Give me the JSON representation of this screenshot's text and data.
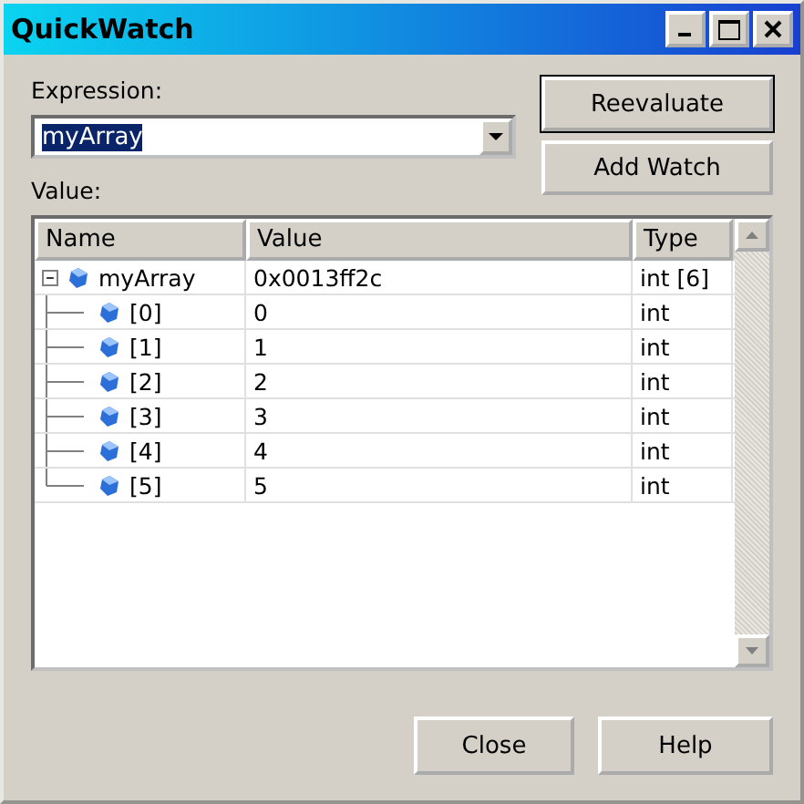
{
  "window": {
    "title": "QuickWatch"
  },
  "expression": {
    "label": "Expression:",
    "value": "myArray"
  },
  "buttons": [
    "Reevaluate",
    "Add Watch"
  ],
  "value_label": "Value:",
  "table": {
    "columns": [
      "Name",
      "Value",
      "Type"
    ],
    "rows": [
      {
        "name": "myArray",
        "value": "0x0013ff2c",
        "type": "int [6]",
        "expanded": true,
        "children": [
          {
            "name": "[0]",
            "value": "0",
            "type": "int"
          },
          {
            "name": "[1]",
            "value": "1",
            "type": "int"
          },
          {
            "name": "[2]",
            "value": "2",
            "type": "int"
          },
          {
            "name": "[3]",
            "value": "3",
            "type": "int"
          },
          {
            "name": "[4]",
            "value": "4",
            "type": "int"
          },
          {
            "name": "[5]",
            "value": "5",
            "type": "int"
          }
        ]
      }
    ]
  },
  "footer_buttons": [
    "Close",
    "Help"
  ]
}
